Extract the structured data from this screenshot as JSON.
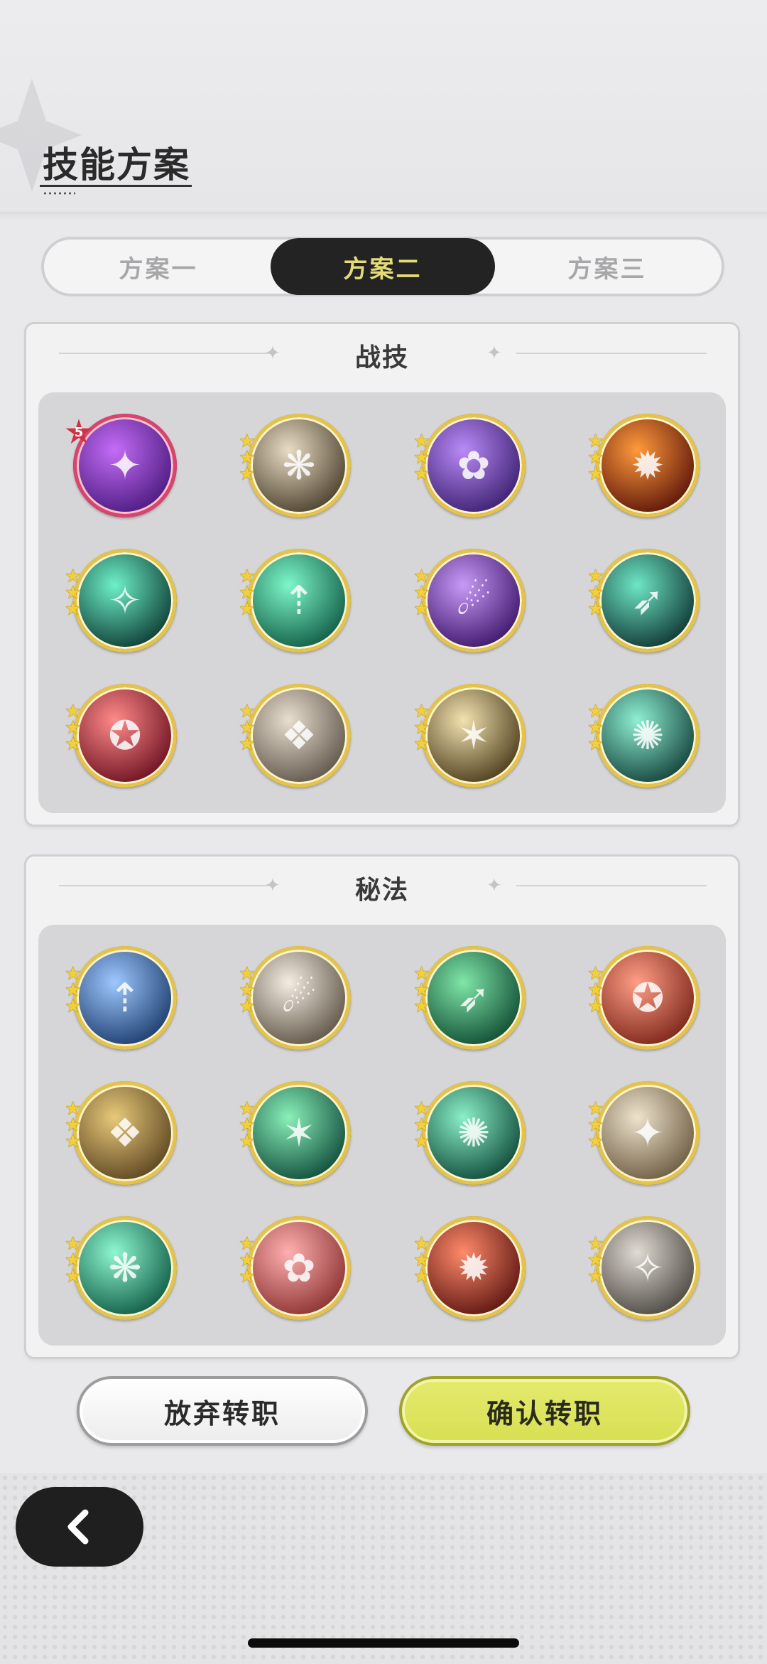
{
  "page": {
    "title": "技能方案"
  },
  "tabs": [
    {
      "label": "方案一",
      "active": false
    },
    {
      "label": "方案二",
      "active": true
    },
    {
      "label": "方案三",
      "active": false
    }
  ],
  "combat_skills": {
    "title": "战技",
    "skills": [
      {
        "icon": "purple-heart-skill-icon",
        "colors": [
          "#c46cf7",
          "#4a1a7e"
        ],
        "stars": 0,
        "level_badge": "5",
        "ring": "#d7456b"
      },
      {
        "icon": "wind-slash-skill-icon",
        "colors": [
          "#e8dcc4",
          "#4a3f2c"
        ],
        "stars": 3
      },
      {
        "icon": "purple-roses-skill-icon",
        "colors": [
          "#b98af7",
          "#3a1f6e"
        ],
        "stars": 3
      },
      {
        "icon": "fire-slash-skill-icon",
        "colors": [
          "#ff9a3c",
          "#5a1308"
        ],
        "stars": 3
      },
      {
        "icon": "green-sword-burst-skill-icon",
        "colors": [
          "#6ef0c7",
          "#0c3a33"
        ],
        "stars": 3
      },
      {
        "icon": "green-arrows-up-skill-icon",
        "colors": [
          "#7ef7c9",
          "#0f5a44"
        ],
        "stars": 3
      },
      {
        "icon": "purple-comet-skill-icon",
        "colors": [
          "#c89af7",
          "#3b1468"
        ],
        "stars": 3
      },
      {
        "icon": "teal-slash-skill-icon",
        "colors": [
          "#6ee6c4",
          "#0e3432"
        ],
        "stars": 3
      },
      {
        "icon": "red-figure-skill-icon",
        "colors": [
          "#ff8a8a",
          "#6a1020"
        ],
        "stars": 3
      },
      {
        "icon": "stampede-skill-icon",
        "colors": [
          "#e8dfd0",
          "#5e5448"
        ],
        "stars": 3
      },
      {
        "icon": "gold-figure-skill-icon",
        "colors": [
          "#f2e2b0",
          "#4a3a1a"
        ],
        "stars": 3
      },
      {
        "icon": "teal-web-skill-icon",
        "colors": [
          "#8ff0d2",
          "#12403b"
        ],
        "stars": 3
      }
    ]
  },
  "secret_arts": {
    "title": "秘法",
    "skills": [
      {
        "icon": "blue-crest-skill-icon",
        "colors": [
          "#9ec8ff",
          "#1b3b6b"
        ],
        "stars": 3
      },
      {
        "icon": "white-blade-skill-icon",
        "colors": [
          "#f4ede2",
          "#5c5244"
        ],
        "stars": 3
      },
      {
        "icon": "green-leaf-skill-icon",
        "colors": [
          "#7fe6a8",
          "#0f4a32"
        ],
        "stars": 3
      },
      {
        "icon": "red-gem-skill-icon",
        "colors": [
          "#ff9e86",
          "#7a2418"
        ],
        "stars": 3
      },
      {
        "icon": "gold-armor-skill-icon",
        "colors": [
          "#e8c97a",
          "#5a4420"
        ],
        "stars": 3
      },
      {
        "icon": "green-heart-skill-icon",
        "colors": [
          "#8af0b8",
          "#0e4a3a"
        ],
        "stars": 3
      },
      {
        "icon": "green-heal-figure-skill-icon",
        "colors": [
          "#8af0c8",
          "#0e4838"
        ],
        "stars": 3
      },
      {
        "icon": "sword-up-skill-icon",
        "colors": [
          "#efe3cc",
          "#6a5a40"
        ],
        "stars": 3
      },
      {
        "icon": "green-feather-skill-icon",
        "colors": [
          "#8ff7d0",
          "#0e5a44"
        ],
        "stars": 3
      },
      {
        "icon": "pink-sword-skill-icon",
        "colors": [
          "#ffb0b0",
          "#8a3030"
        ],
        "stars": 3
      },
      {
        "icon": "red-strike-skill-icon",
        "colors": [
          "#ff8a6a",
          "#5a1410"
        ],
        "stars": 3
      },
      {
        "icon": "grey-shield-figure-skill-icon",
        "colors": [
          "#e0dcd4",
          "#4a4640"
        ],
        "stars": 3
      }
    ]
  },
  "buttons": {
    "abandon": "放弃转职",
    "confirm": "确认转职"
  },
  "nav": {
    "back_icon": "chevron-left-icon"
  }
}
